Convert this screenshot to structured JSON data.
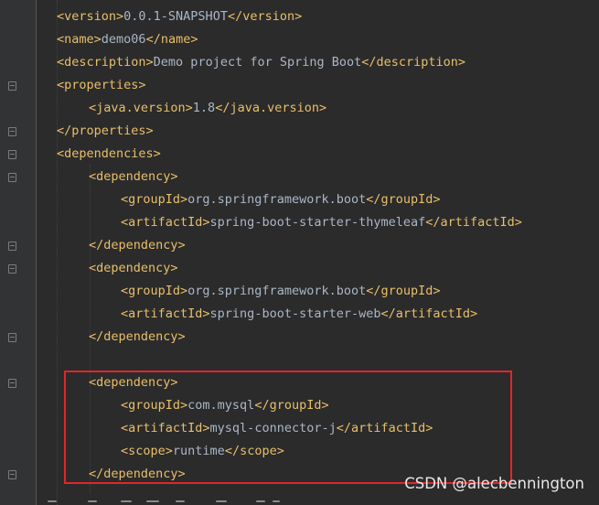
{
  "editor": {
    "lines": [
      {
        "open": "<version>",
        "text": "0.0.1-SNAPSHOT",
        "close": "</version>"
      },
      {
        "open": "<name>",
        "text": "demo06",
        "close": "</name>"
      },
      {
        "open": "<description>",
        "text": "Demo project for Spring Boot",
        "close": "</description>"
      },
      {
        "open": "<properties>",
        "text": "",
        "close": ""
      },
      {
        "open": "<java.version>",
        "text": "1.8",
        "close": "</java.version>"
      },
      {
        "open": "</properties>",
        "text": "",
        "close": ""
      },
      {
        "open": "<dependencies>",
        "text": "",
        "close": ""
      },
      {
        "open": "<dependency>",
        "text": "",
        "close": ""
      },
      {
        "open": "<groupId>",
        "text": "org.springframework.boot",
        "close": "</groupId>"
      },
      {
        "open": "<artifactId>",
        "text": "spring-boot-starter-thymeleaf",
        "close": "</artifactId>"
      },
      {
        "open": "</dependency>",
        "text": "",
        "close": ""
      },
      {
        "open": "<dependency>",
        "text": "",
        "close": ""
      },
      {
        "open": "<groupId>",
        "text": "org.springframework.boot",
        "close": "</groupId>"
      },
      {
        "open": "<artifactId>",
        "text": "spring-boot-starter-web",
        "close": "</artifactId>"
      },
      {
        "open": "</dependency>",
        "text": "",
        "close": ""
      },
      {
        "open": "",
        "text": "",
        "close": ""
      },
      {
        "open": "<dependency>",
        "text": "",
        "close": ""
      },
      {
        "open": "<groupId>",
        "text": "com.mysql",
        "close": "</groupId>"
      },
      {
        "open": "<artifactId>",
        "text": "mysql-connector-j",
        "close": "</artifactId>"
      },
      {
        "open": "<scope>",
        "text": "runtime",
        "close": "</scope>"
      },
      {
        "open": "</dependency>",
        "text": "",
        "close": ""
      }
    ]
  },
  "watermark": "CSDN @alecbennington",
  "colors": {
    "background": "#2b2b2b",
    "gutter": "#313335",
    "tag": "#e8bf6a",
    "text": "#a9b7c6",
    "highlight_box": "#e0262b"
  }
}
